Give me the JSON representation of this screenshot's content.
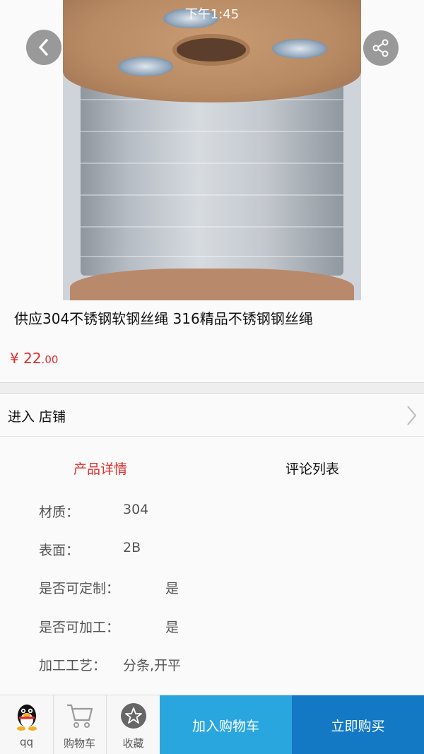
{
  "status_bar": {
    "time": "下午1:45"
  },
  "header": {
    "back_icon": "chevron-left-icon",
    "share_icon": "share-icon"
  },
  "product": {
    "title": "供应304不锈钢软钢丝绳 316精品不锈钢钢丝绳",
    "price_symbol": "¥",
    "price_integer": "22",
    "price_decimal": ".00"
  },
  "shop": {
    "label": "进入 店铺",
    "chevron_icon": "chevron-right-icon"
  },
  "tabs": [
    {
      "label": "产品详情",
      "active": true
    },
    {
      "label": "评论列表",
      "active": false
    }
  ],
  "specs": [
    {
      "label": "材质：",
      "value": "304"
    },
    {
      "label": "表面：",
      "value": "2B"
    },
    {
      "label": "是否可定制：",
      "value": "是"
    },
    {
      "label": "是否可加工：",
      "value": "是"
    },
    {
      "label": "加工工艺：",
      "value": "分条,开平"
    }
  ],
  "bottom_bar": {
    "qq_label": "qq",
    "cart_label": "购物车",
    "favorite_label": "收藏",
    "add_to_cart": "加入购物车",
    "buy_now": "立即购买"
  },
  "colors": {
    "accent_red": "#e32b2b",
    "add_cart_blue": "#2aa6de",
    "buy_blue": "#1479c5"
  }
}
